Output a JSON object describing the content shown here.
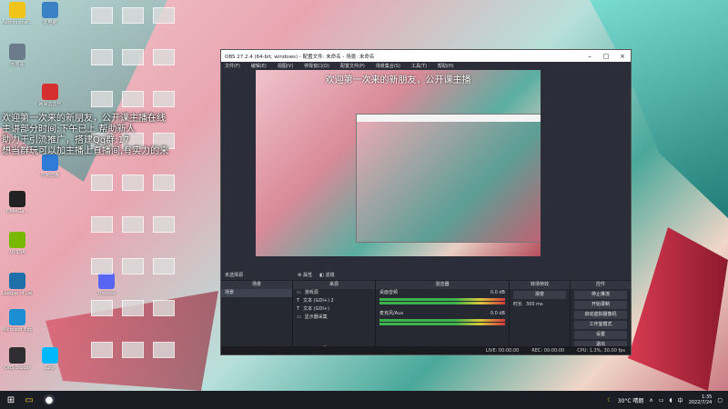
{
  "overlay": {
    "title": "欢迎第一次来的新朋友，公开课主播",
    "lines": [
      "欢迎第一次来的新朋友，公开课主播在线",
      "主讲部分时间:下午已上 帮助新人",
      "助力于引流推广，搭建Qq群:17",
      "想当群玩可以加主播上直播间,有实力的来"
    ]
  },
  "obs": {
    "title": "OBS 27.2.4 (64-bit, windows) - 配置文件: 未命名 - 场景: 未命名",
    "menu": [
      "文件(F)",
      "编辑(E)",
      "视图(V)",
      "停靠窗口(D)",
      "配置文件(P)",
      "场景集合(S)",
      "工具(T)",
      "帮助(H)"
    ],
    "no_source": "未选择源",
    "props": "属性",
    "filters": "滤镜",
    "docks": {
      "scenes": {
        "title": "场景",
        "items": [
          "场景"
        ]
      },
      "sources": {
        "title": "来源",
        "items": [
          "游戏源",
          "文本 (GDI+) 2",
          "文本 (GDI+)",
          "显示器采集"
        ]
      },
      "mixer": {
        "title": "混音器",
        "items": [
          {
            "name": "桌面音频",
            "level": "0.0 dB"
          },
          {
            "name": "麦克风/Aux",
            "level": "0.0 dB"
          }
        ]
      },
      "transitions": {
        "title": "转场特效",
        "type": "渐变",
        "duration_label": "时长",
        "duration": "300 ms"
      },
      "controls": {
        "title": "控件",
        "buttons": [
          "停止推流",
          "开始录制",
          "启动虚拟摄像机",
          "工作室模式",
          "设置",
          "退出"
        ]
      }
    },
    "status": {
      "dropped": "LIVE: 00:00:00",
      "rec": "REC: 00:00:00",
      "cpu": "CPU: 1.3%, 30.00 fps"
    }
  },
  "desktop_icons": [
    {
      "label": "Administrat...",
      "color": "#f0c419"
    },
    {
      "label": "此电脑",
      "color": "#3b82c4"
    },
    {
      "label": "回收站",
      "color": "#6b7b8c"
    },
    {
      "label": "网易云音乐",
      "color": "#d62f2f"
    },
    {
      "label": "控制面板",
      "color": "#2f7bd8"
    },
    {
      "label": "DMMGa...",
      "color": "#222222"
    },
    {
      "label": "NVIDIA",
      "color": "#76b900"
    },
    {
      "label": "Discord",
      "color": "#5865f2"
    },
    {
      "label": "League of Legends",
      "color": "#1f6fa8"
    },
    {
      "label": "Microsoft Edge",
      "color": "#1b8fd1"
    },
    {
      "label": "OBS Studio",
      "color": "#302e31"
    },
    {
      "label": "Logi",
      "color": "#00b8fc"
    }
  ],
  "taskbar": {
    "weather": "30°C 晴朗",
    "time": "1:35",
    "date": "2022/7/24",
    "lang": "中"
  }
}
